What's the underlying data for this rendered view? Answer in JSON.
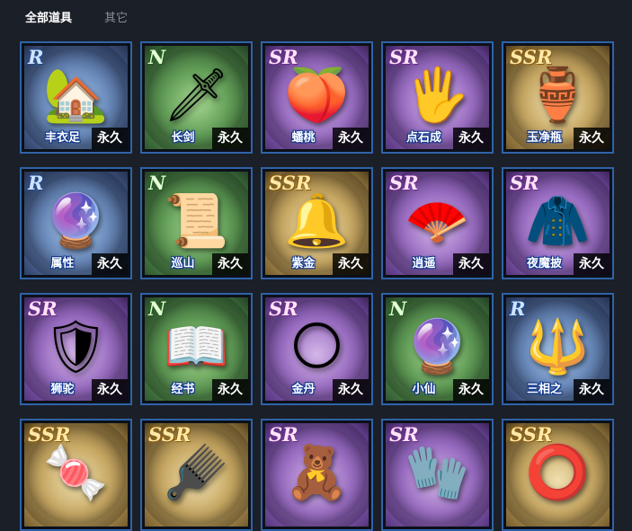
{
  "tabs": {
    "all": "全部道具",
    "other": "其它"
  },
  "items": [
    {
      "rarity": "R",
      "tier": "r",
      "name": "丰衣足",
      "duration": "永久",
      "icon": "🏡"
    },
    {
      "rarity": "N",
      "tier": "n",
      "name": "长剑",
      "duration": "永久",
      "icon": "🗡"
    },
    {
      "rarity": "SR",
      "tier": "sr",
      "name": "蟠桃",
      "duration": "永久",
      "icon": "🍑"
    },
    {
      "rarity": "SR",
      "tier": "sr",
      "name": "点石成",
      "duration": "永久",
      "icon": "🖐"
    },
    {
      "rarity": "SSR",
      "tier": "ssr",
      "name": "玉净瓶",
      "duration": "永久",
      "icon": "🏺"
    },
    {
      "rarity": "R",
      "tier": "r",
      "name": "属性",
      "duration": "永久",
      "icon": "🔮"
    },
    {
      "rarity": "N",
      "tier": "n",
      "name": "巡山",
      "duration": "永久",
      "icon": "📜"
    },
    {
      "rarity": "SSR",
      "tier": "ssr",
      "name": "紫金",
      "duration": "永久",
      "icon": "🔔"
    },
    {
      "rarity": "SR",
      "tier": "sr",
      "name": "逍遥",
      "duration": "永久",
      "icon": "🪭"
    },
    {
      "rarity": "SR",
      "tier": "sr",
      "name": "夜魔披",
      "duration": "永久",
      "icon": "🧥"
    },
    {
      "rarity": "SR",
      "tier": "sr",
      "name": "狮驼",
      "duration": "永久",
      "icon": "🛡"
    },
    {
      "rarity": "N",
      "tier": "n",
      "name": "经书",
      "duration": "永久",
      "icon": "📖"
    },
    {
      "rarity": "SR",
      "tier": "sr",
      "name": "金丹",
      "duration": "永久",
      "icon": "🌕"
    },
    {
      "rarity": "N",
      "tier": "n",
      "name": "小仙",
      "duration": "永久",
      "icon": "🔮"
    },
    {
      "rarity": "R",
      "tier": "r",
      "name": "三相之",
      "duration": "永久",
      "icon": "🔱"
    },
    {
      "rarity": "SSR",
      "tier": "ssr",
      "name": "",
      "duration": "",
      "icon": "🍬"
    },
    {
      "rarity": "SSR",
      "tier": "ssr",
      "name": "",
      "duration": "",
      "icon": "🪮"
    },
    {
      "rarity": "SR",
      "tier": "sr",
      "name": "",
      "duration": "",
      "icon": "🧸"
    },
    {
      "rarity": "SR",
      "tier": "sr",
      "name": "",
      "duration": "",
      "icon": "🧤"
    },
    {
      "rarity": "SSR",
      "tier": "ssr",
      "name": "",
      "duration": "",
      "icon": "⭕"
    }
  ]
}
